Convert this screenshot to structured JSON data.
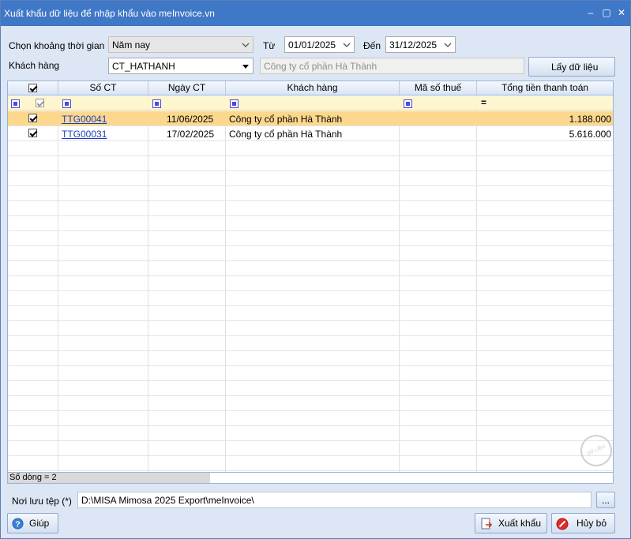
{
  "window": {
    "title": "Xuất khẩu dữ liệu để nhập khẩu vào meInvoice.vn",
    "minimize_glyph": "–",
    "maximize_glyph": "▢",
    "close_glyph": "✕"
  },
  "filters": {
    "period_label": "Chọn khoảng thời gian",
    "period_value": "Năm nay",
    "from_label": "Từ",
    "from_value": "01/01/2025",
    "to_label": "Đến",
    "to_value": "31/12/2025",
    "customer_label": "Khách hàng",
    "customer_code": "CT_HATHANH",
    "customer_name": "Công ty cổ phần Hà Thành",
    "fetch_button": "Lấy dữ liệu"
  },
  "table": {
    "columns": [
      "",
      "Số CT",
      "Ngày CT",
      "Khách hàng",
      "Mã số thuế",
      "Tổng tiền thanh toán"
    ],
    "filter_total_op": "=",
    "rows": [
      {
        "checked": true,
        "so_ct": "TTG00041",
        "ngay_ct": "11/06/2025",
        "khach_hang": "Công ty cổ phần Hà Thành",
        "ma_so_thue": "",
        "tong_tien": "1.188.000"
      },
      {
        "checked": true,
        "so_ct": "TTG00031",
        "ngay_ct": "17/02/2025",
        "khach_hang": "Công ty cổ phần Hà Thành",
        "ma_so_thue": "",
        "tong_tien": "5.616.000"
      }
    ]
  },
  "status": {
    "row_count": "Số dòng = 2"
  },
  "save_path": {
    "label": "Nơi lưu tệp (*)",
    "value": "D:\\MISA Mimosa 2025 Export\\meInvoice\\",
    "browse": "..."
  },
  "footer": {
    "help": "Giúp",
    "export": "Xuất khẩu",
    "cancel": "Hủy bỏ"
  },
  "watermark": "DỮ LIỆU MẪU",
  "colors": {
    "titlebar": "#3f78c6",
    "selected_row": "#fcd88e",
    "filter_row": "#fdf6d1",
    "link": "#1f3fb8"
  }
}
